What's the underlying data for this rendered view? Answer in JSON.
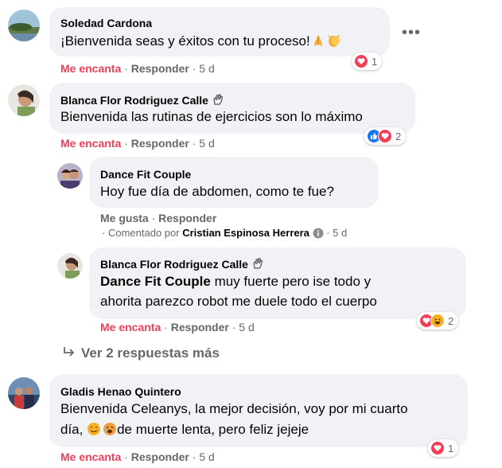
{
  "comments": [
    {
      "author": "Soledad Cardona",
      "text": "¡Bienvenida seas y éxitos con tu proceso!",
      "text_emojis": [
        "folded-hands",
        "clapping-hands"
      ],
      "action_react": "Me encanta",
      "reply": "Responder",
      "time": "5 d",
      "reactions": [
        "love"
      ],
      "reaction_count": "1"
    },
    {
      "author": "Blanca Flor Rodriguez Calle",
      "author_badge": "waving-hand",
      "text": "Bienvenida las rutinas de ejercicios son lo máximo",
      "action_react": "Me encanta",
      "reply": "Responder",
      "time": "5 d",
      "reactions": [
        "like",
        "love"
      ],
      "reaction_count": "2",
      "replies": [
        {
          "author": "Dance Fit Couple",
          "text": "Hoy fue día de abdomen, como te fue?",
          "action_react": "Me gusta",
          "reply": "Responder",
          "commented_by_prefix": "Comentado por",
          "commented_by_name": "Cristian Espinosa Herrera",
          "time": "5 d"
        },
        {
          "author": "Blanca Flor Rodriguez Calle",
          "author_badge": "waving-hand",
          "mention": "Dance Fit Couple",
          "text_line1": "muy fuerte pero ise todo y",
          "text_line2": "ahorita parezco robot me duele todo el cuerpo",
          "action_react": "Me encanta",
          "reply": "Responder",
          "time": "5 d",
          "reactions": [
            "love",
            "haha"
          ],
          "reaction_count": "2"
        }
      ],
      "view_more": "Ver 2 respuestas más"
    },
    {
      "author": "Gladis Henao Quintero",
      "text_line1": "Bienvenida Celeanys, la mejor decisión, voy por mi cuarto",
      "text_line2_prefix": "día,",
      "text_line2_suffix": "de muerte lenta, pero feliz jejeje",
      "text_emojis": [
        "smiling-face",
        "hot-face"
      ],
      "action_react": "Me encanta",
      "reply": "Responder",
      "time": "5 d",
      "reactions": [
        "love"
      ],
      "reaction_count": "1"
    }
  ],
  "separator": "·",
  "more_menu": "•••",
  "colors": {
    "love": "#f33e58",
    "like": "#1877f2",
    "haha": "#f7b125",
    "bubble": "#f0f2f5",
    "meta": "#65676b"
  }
}
